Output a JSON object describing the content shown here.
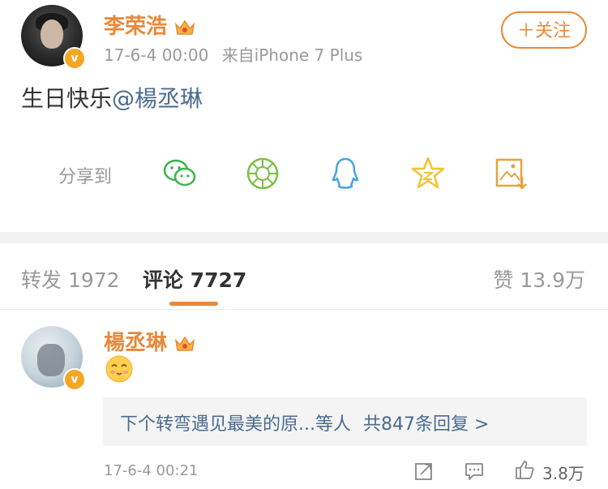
{
  "post": {
    "author": "李荣浩",
    "timestamp": "17-6-4 00:00",
    "source": "来自iPhone 7 Plus",
    "follow_label": "＋关注",
    "text_prefix": "生日快乐",
    "mention": "@楊丞琳"
  },
  "share": {
    "label": "分享到",
    "targets": [
      "wechat-icon",
      "moments-icon",
      "qq-icon",
      "qzone-icon",
      "save-image-icon"
    ]
  },
  "tabs": {
    "repost_label": "转发",
    "repost_count": "1972",
    "comment_label": "评论",
    "comment_count": "7727",
    "like_label": "赞",
    "like_count": "13.9万"
  },
  "comment": {
    "author": "楊丞琳",
    "reply_summary": "下个转弯遇见最美的原...等人",
    "reply_link": "共847条回复 >",
    "timestamp": "17-6-4 00:21",
    "like_count": "3.8万"
  },
  "colors": {
    "accent": "#e8883a",
    "link": "#4a6b8f",
    "wechat": "#3bb54a",
    "moments": "#7ac043",
    "qq": "#4aa3df",
    "qzone": "#f2c230",
    "save": "#e8a13a"
  }
}
